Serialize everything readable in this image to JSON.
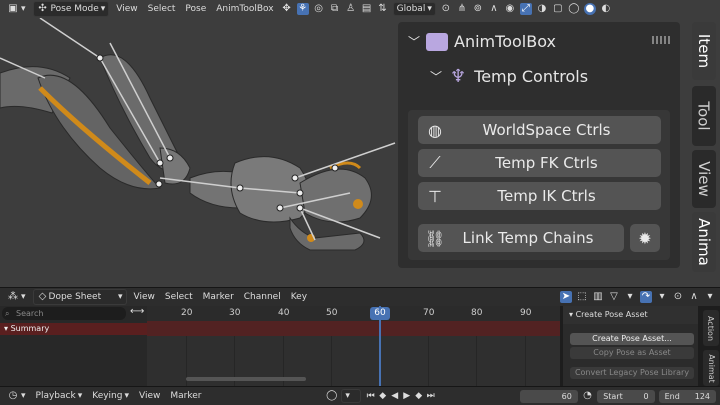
{
  "viewport_header": {
    "mode": "Pose Mode",
    "menus": [
      "View",
      "Select",
      "Pose",
      "AnimToolBox"
    ],
    "orientation": "Global"
  },
  "npanel": {
    "title": "AnimToolBox",
    "subtitle": "Temp Controls",
    "buttons": [
      {
        "label": "WorldSpace Ctrls",
        "icon": "globe-icon"
      },
      {
        "label": "Temp FK Ctrls",
        "icon": "bone-icon"
      },
      {
        "label": "Temp IK Ctrls",
        "icon": "ik-chain-icon"
      },
      {
        "label": "Link Temp Chains",
        "icon": "link-icon"
      }
    ],
    "side_tabs": [
      "Item",
      "Tool",
      "View",
      "Anima"
    ]
  },
  "dopesheet": {
    "editor": "Dope Sheet",
    "menus": [
      "View",
      "Select",
      "Marker",
      "Channel",
      "Key"
    ],
    "search_placeholder": "Search",
    "summary_label": "Summary",
    "ruler_ticks": [
      "20",
      "30",
      "40",
      "50",
      "60",
      "70",
      "80",
      "90"
    ],
    "current_frame": "60"
  },
  "pose_asset": {
    "title": "Create Pose Asset",
    "create_button": "Create Pose Asset...",
    "copy_button": "Copy Pose as Asset",
    "convert_button": "Convert Legacy Pose Library",
    "side_tabs": [
      "Action",
      "Animat"
    ]
  },
  "timeline": {
    "menus": [
      "Playback",
      "Keying",
      "View",
      "Marker"
    ],
    "frame": "60",
    "start_label": "Start",
    "start_value": "0",
    "end_label": "End",
    "end_value": "124"
  }
}
